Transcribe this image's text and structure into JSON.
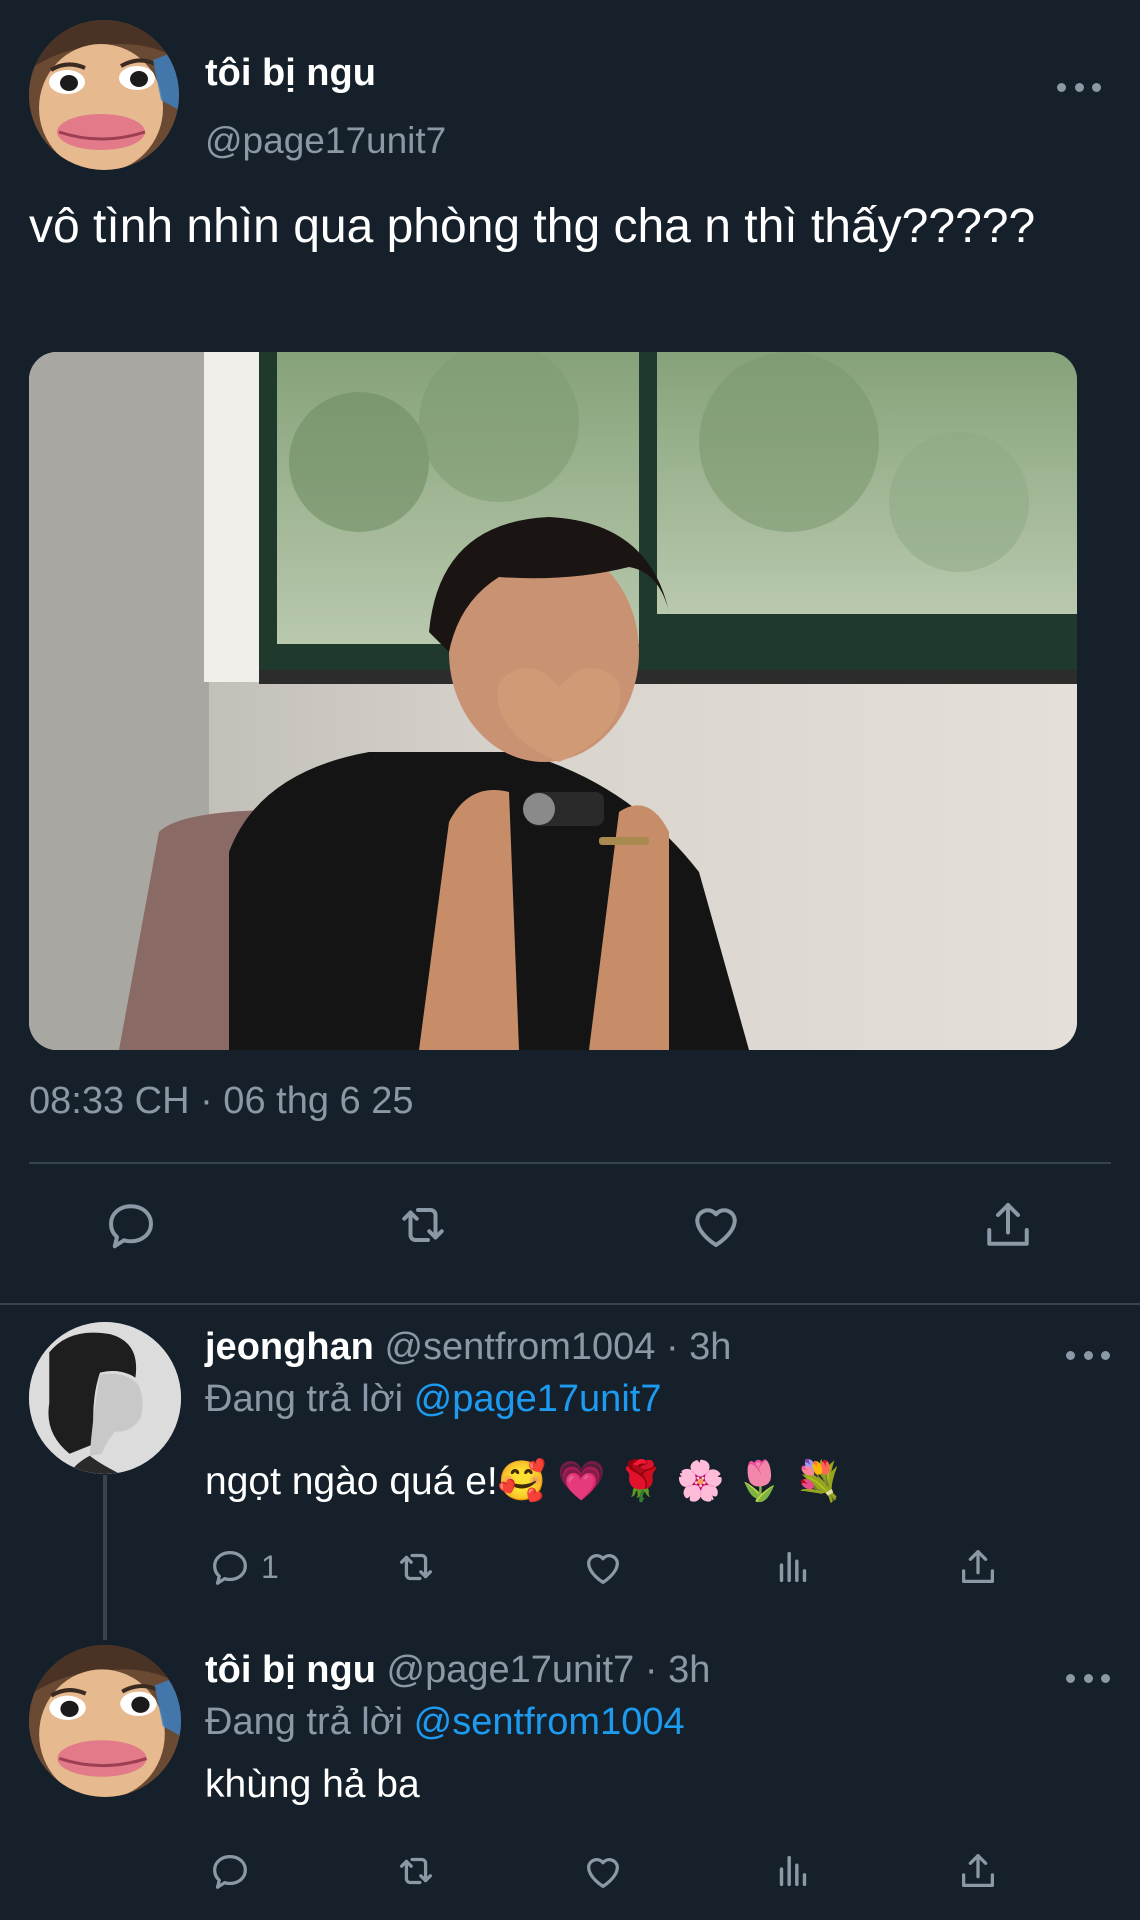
{
  "main_tweet": {
    "display_name": "tôi bị ngu",
    "handle": "@page17unit7",
    "text": "vô tình nhìn qua phòng thg cha n thì thấy?????",
    "timestamp": "08:33 CH · 06 thg 6 25",
    "actions": {
      "reply_icon": "reply-icon",
      "retweet_icon": "retweet-icon",
      "like_icon": "heart-icon",
      "share_icon": "share-icon"
    }
  },
  "replies": [
    {
      "display_name": "jeonghan",
      "handle": "@sentfrom1004",
      "separator": " · ",
      "time": "3h",
      "replying_prefix": "Đang trả lời ",
      "replying_to": "@page17unit7",
      "text": "ngọt ngào quá e!🥰 💗 🌹 🌸 🌷 💐",
      "reply_count": "1"
    },
    {
      "display_name": "tôi bị ngu",
      "handle": "@page17unit7",
      "separator": " · ",
      "time": "3h",
      "replying_prefix": "Đang trả lời ",
      "replying_to": "@sentfrom1004",
      "text": "khùng hả ba",
      "reply_count": ""
    }
  ],
  "colors": {
    "background": "#15202b",
    "secondary_text": "#8b98a5",
    "link": "#1d9bf0",
    "divider": "#38444d"
  }
}
